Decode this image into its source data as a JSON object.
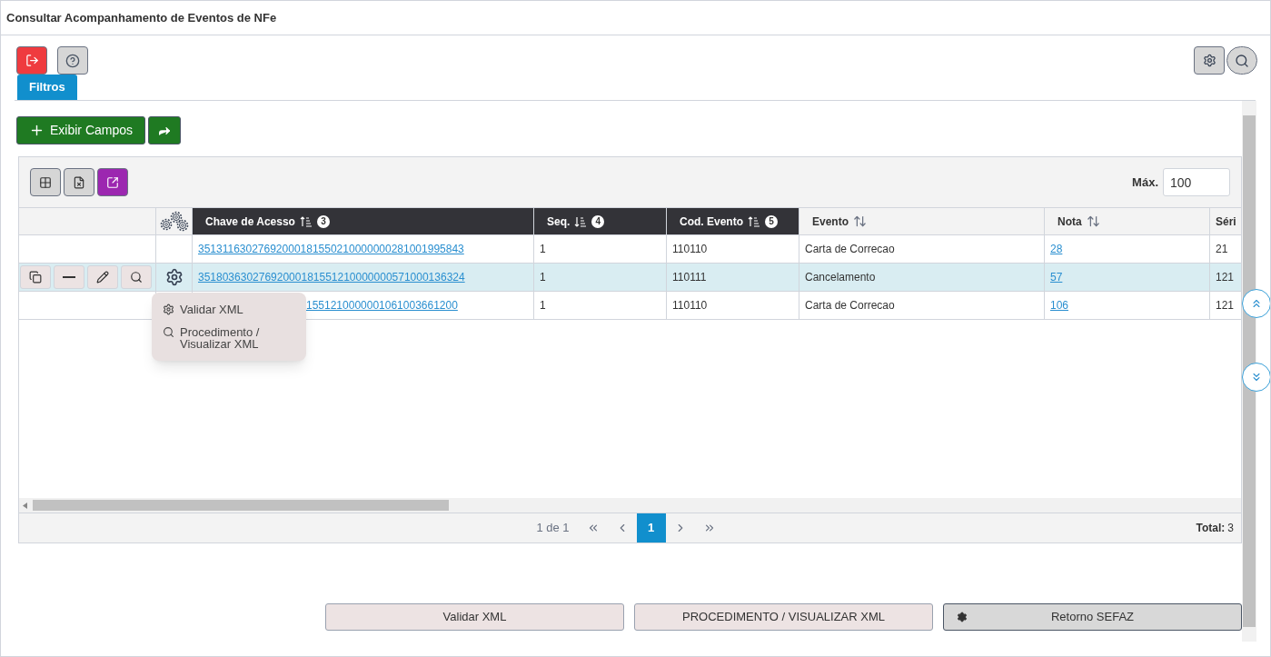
{
  "window": {
    "title": "Consultar Acompanhamento de Eventos de NFe"
  },
  "filters_tab": {
    "label": "Filtros",
    "selected": true
  },
  "show_fields_button": {
    "label": "Exibir Campos"
  },
  "max_field": {
    "label": "Máx.",
    "value": "100"
  },
  "columns": [
    {
      "label": "Chave de Acesso",
      "kind": "ascending",
      "order": "3"
    },
    {
      "label": "Seq.",
      "kind": "descending",
      "order": "4"
    },
    {
      "label": "Cod. Evento",
      "kind": "ascending",
      "order": "5"
    },
    {
      "label": "Evento",
      "kind": "unsorted"
    },
    {
      "label": "Nota",
      "kind": "unsorted"
    },
    {
      "label": "Séri",
      "kind": "plain"
    }
  ],
  "rows": [
    {
      "selected": false,
      "menu_open": false,
      "cells": [
        "35131163027692000181550210000000281001995843",
        "1",
        "110110",
        "Carta de Correcao",
        "28",
        "21"
      ]
    },
    {
      "selected": true,
      "menu_open": true,
      "cells": [
        "35180363027692000181551210000000571000136324",
        "1",
        "110111",
        "Cancelamento",
        "57",
        "121"
      ]
    },
    {
      "selected": false,
      "menu_open": false,
      "cells": [
        "1551210000001061003661200",
        "1",
        "110110",
        "Carta de Correcao",
        "106",
        "121"
      ]
    }
  ],
  "row_menu": [
    {
      "label": "Validar XML"
    },
    {
      "label": "Procedimento / Visualizar XML"
    }
  ],
  "pagination": {
    "summary": "1 de 1",
    "pages": [
      {
        "label": "1",
        "selected": true
      }
    ],
    "total_label": "Total:",
    "total": "3"
  },
  "bottom_buttons": [
    {
      "label": "Validar XML",
      "kind": "plain"
    },
    {
      "label": "PROCEDIMENTO / VISUALIZAR XML",
      "kind": "plain"
    },
    {
      "label": "Retorno SEFAZ",
      "kind": "gear"
    }
  ]
}
